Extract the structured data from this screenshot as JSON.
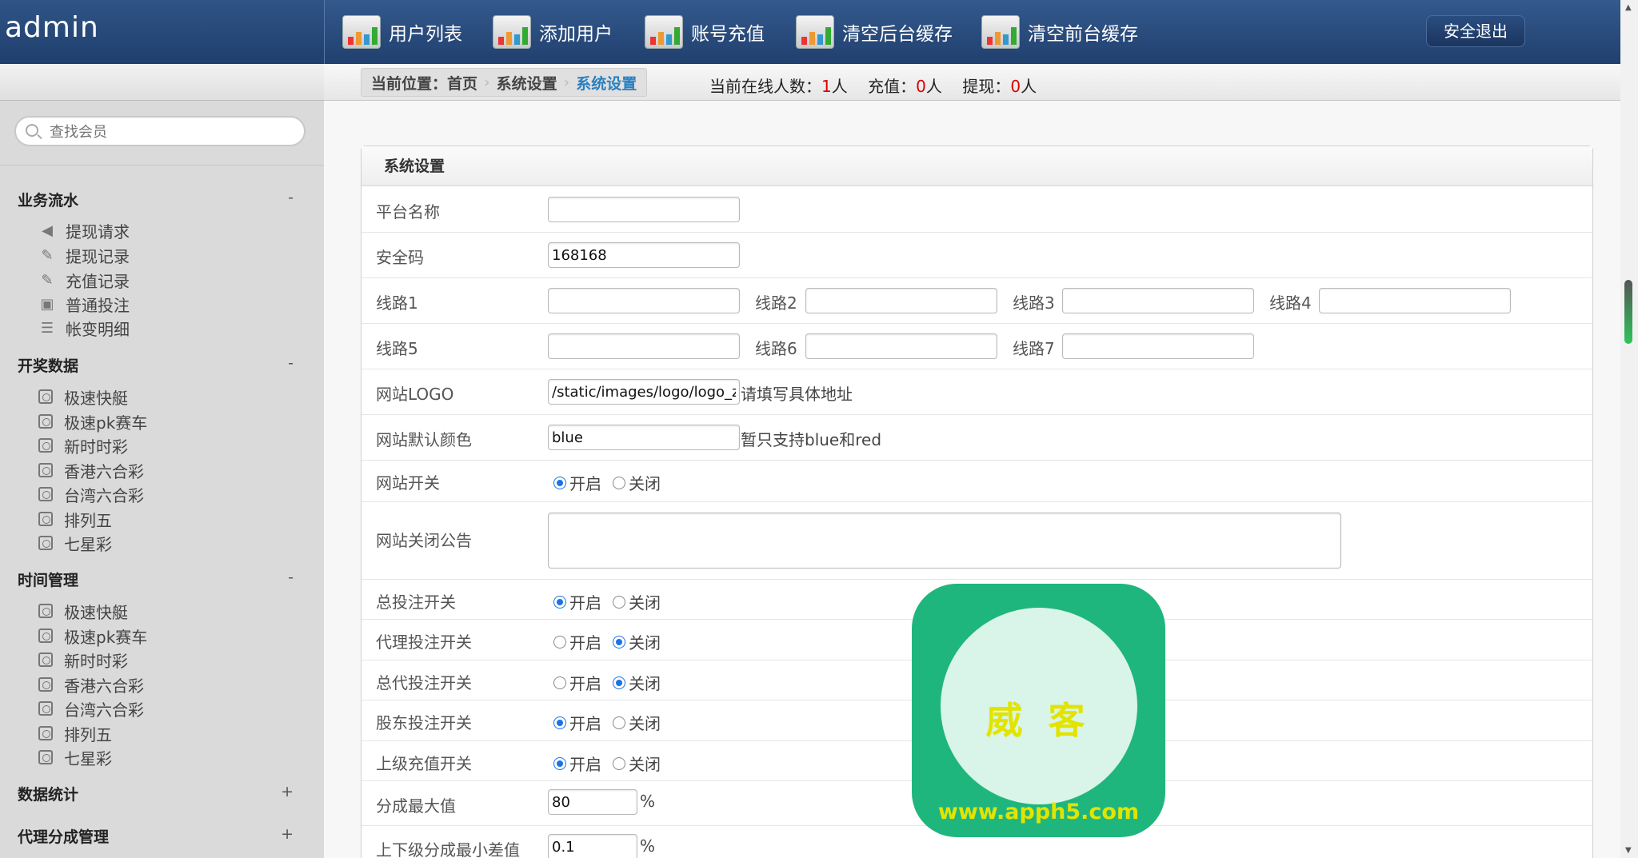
{
  "app": {
    "title": "admin"
  },
  "nav": [
    {
      "label": "用户列表"
    },
    {
      "label": "添加用户"
    },
    {
      "label": "账号充值"
    },
    {
      "label": "清空后台缓存"
    },
    {
      "label": "清空前台缓存"
    }
  ],
  "logout_label": "安全退出",
  "search": {
    "placeholder": "查找会员"
  },
  "sidebar": {
    "groups": [
      {
        "title": "业务流水",
        "toggle": "-",
        "items": [
          "提现请求",
          "提现记录",
          "充值记录",
          "普通投注",
          "帐变明细"
        ]
      },
      {
        "title": "开奖数据",
        "toggle": "-",
        "items": [
          "极速快艇",
          "极速pk赛车",
          "新时时彩",
          "香港六合彩",
          "台湾六合彩",
          "排列五",
          "七星彩"
        ]
      },
      {
        "title": "时间管理",
        "toggle": "-",
        "items": [
          "极速快艇",
          "极速pk赛车",
          "新时时彩",
          "香港六合彩",
          "台湾六合彩",
          "排列五",
          "七星彩"
        ]
      },
      {
        "title": "数据统计",
        "toggle": "+"
      },
      {
        "title": "代理分成管理",
        "toggle": "+"
      }
    ]
  },
  "breadcrumb": {
    "prefix": "当前位置：首页",
    "mid": "系统设置",
    "current": "系统设置"
  },
  "stats": {
    "online_label": "当前在线人数：",
    "online": "1",
    "online_unit": "人",
    "recharge_label": "充值：",
    "recharge": "0",
    "recharge_unit": "人",
    "withdraw_label": "提现：",
    "withdraw": "0",
    "withdraw_unit": "人"
  },
  "panel": {
    "title": "系统设置"
  },
  "form": {
    "platform_name": {
      "label": "平台名称",
      "value": ""
    },
    "security_code": {
      "label": "安全码",
      "value": "168168"
    },
    "line1": {
      "label": "线路1",
      "value": ""
    },
    "line2": {
      "label": "线路2",
      "value": ""
    },
    "line3": {
      "label": "线路3",
      "value": ""
    },
    "line4": {
      "label": "线路4",
      "value": ""
    },
    "line5": {
      "label": "线路5",
      "value": ""
    },
    "line6": {
      "label": "线路6",
      "value": ""
    },
    "line7": {
      "label": "线路7",
      "value": ""
    },
    "logo": {
      "label": "网站LOGO",
      "value": "/static/images/logo/logo_zc.png",
      "hint": "请填写具体地址"
    },
    "color": {
      "label": "网站默认颜色",
      "value": "blue",
      "hint": "暂只支持blue和red"
    },
    "site_switch": {
      "label": "网站开关",
      "selected": "on"
    },
    "close_notice": {
      "label": "网站关闭公告",
      "value": ""
    },
    "bet_switch": {
      "label": "总投注开关",
      "selected": "on"
    },
    "agent_bet_switch": {
      "label": "代理投注开关",
      "selected": "off"
    },
    "general_agent_bet_switch": {
      "label": "总代投注开关",
      "selected": "off"
    },
    "shareholder_bet_switch": {
      "label": "股东投注开关",
      "selected": "on"
    },
    "parent_recharge_switch": {
      "label": "上级充值开关",
      "selected": "on"
    },
    "share_max": {
      "label": "分成最大值",
      "value": "80",
      "unit": "%"
    },
    "share_min_diff": {
      "label": "上下级分成最小差值",
      "value": "0.1",
      "unit": "%"
    },
    "on_label": "开启",
    "off_label": "关闭"
  },
  "watermark": {
    "text": "威 客",
    "url": "www.apph5.com"
  },
  "colors": {
    "header": "#1f3f6e",
    "accent": "#2a7fc0",
    "red": "#dd0000",
    "watermark": "#1fb67d"
  }
}
